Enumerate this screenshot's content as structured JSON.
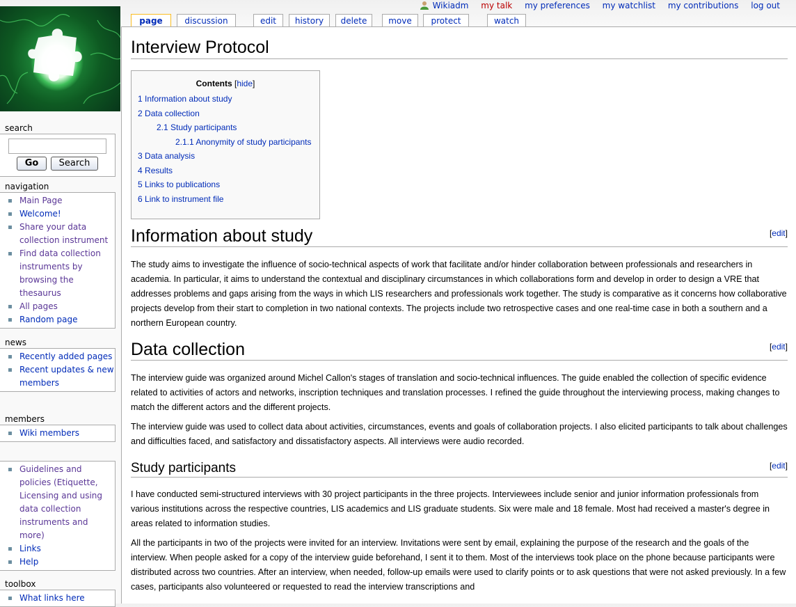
{
  "personal": {
    "user": "Wikiadm",
    "my_talk": "my talk",
    "my_preferences": "my preferences",
    "my_watchlist": "my watchlist",
    "my_contributions": "my contributions",
    "log_out": "log out"
  },
  "tabs": {
    "page": "page",
    "discussion": "discussion",
    "edit": "edit",
    "history": "history",
    "delete": "delete",
    "move": "move",
    "protect": "protect",
    "watch": "watch"
  },
  "sidebar": {
    "search": {
      "heading": "search",
      "input_value": "",
      "go_label": "Go",
      "search_label": "Search"
    },
    "navigation": {
      "heading": "navigation",
      "items": [
        "Main Page",
        "Welcome!",
        "Share your data collection instrument",
        "Find data collection instruments by browsing the thesaurus",
        "All pages",
        "Random page"
      ]
    },
    "news": {
      "heading": "news",
      "items": [
        "Recently added pages",
        "Recent updates & new members"
      ]
    },
    "members": {
      "heading": "members",
      "items": [
        "Wiki members"
      ]
    },
    "misc": {
      "heading": "",
      "items": [
        "Guidelines and policies (Etiquette, Licensing and using data collection instruments and more)",
        "Links",
        "Help"
      ]
    },
    "toolbox": {
      "heading": "toolbox",
      "items": [
        "What links here"
      ]
    }
  },
  "page": {
    "title": "Interview Protocol",
    "toc": {
      "title": "Contents",
      "hide_label": "hide",
      "items": [
        {
          "num": "1",
          "label": "Information about study",
          "level": 1
        },
        {
          "num": "2",
          "label": "Data collection",
          "level": 1
        },
        {
          "num": "2.1",
          "label": "Study participants",
          "level": 2
        },
        {
          "num": "2.1.1",
          "label": "Anonymity of study participants",
          "level": 3
        },
        {
          "num": "3",
          "label": "Data analysis",
          "level": 1
        },
        {
          "num": "4",
          "label": "Results",
          "level": 1
        },
        {
          "num": "5",
          "label": "Links to publications",
          "level": 1
        },
        {
          "num": "6",
          "label": "Link to instrument file",
          "level": 1
        }
      ]
    },
    "edit_label": "edit",
    "sections": [
      {
        "heading": "Information about study",
        "paragraphs": [
          "The study aims to investigate the influence of socio-technical aspects of work that facilitate and/or hinder collaboration between professionals and researchers in academia. In particular, it aims to understand the contextual and disciplinary circumstances in which collaborations form and develop in order to design a VRE that addresses problems and gaps arising from the ways in which LIS researchers and professionals work together. The study is comparative as it concerns how collaborative projects develop from their start to completion in two national contexts. The projects include two retrospective cases and one real-time case in both a southern and a northern European country."
        ]
      },
      {
        "heading": "Data collection",
        "paragraphs": [
          "The interview guide was organized around Michel Callon's stages of translation and socio-technical influences. The guide enabled the collection of specific evidence related to activities of actors and networks, inscription techniques and translation processes. I refined the guide throughout the interviewing process, making changes to match the different actors and the different projects.",
          "The interview guide was used to collect data about activities, circumstances, events and goals of collaboration projects. I also elicited participants to talk about challenges and difficulties faced, and satisfactory and dissatisfactory aspects. All interviews were audio recorded."
        ]
      },
      {
        "heading": "Study participants",
        "paragraphs": [
          "I have conducted semi-structured interviews with 30 project participants in the three projects. Interviewees include senior and junior information professionals from various institutions across the respective countries, LIS academics and LIS graduate students. Six were male and 18 female. Most had received a master's degree in areas related to information studies.",
          "All the participants in two of the projects were invited for an interview. Invitations were sent by email, explaining the purpose of the research and the goals of the interview. When people asked for a copy of the interview guide beforehand, I sent it to them. Most of the interviews took place on the phone because participants were distributed across two countries. After an interview, when needed, follow-up emails were used to clarify points or to ask questions that were not asked previously. In a few cases, participants also volunteered or requested to read the interview transcriptions and"
        ]
      }
    ]
  }
}
